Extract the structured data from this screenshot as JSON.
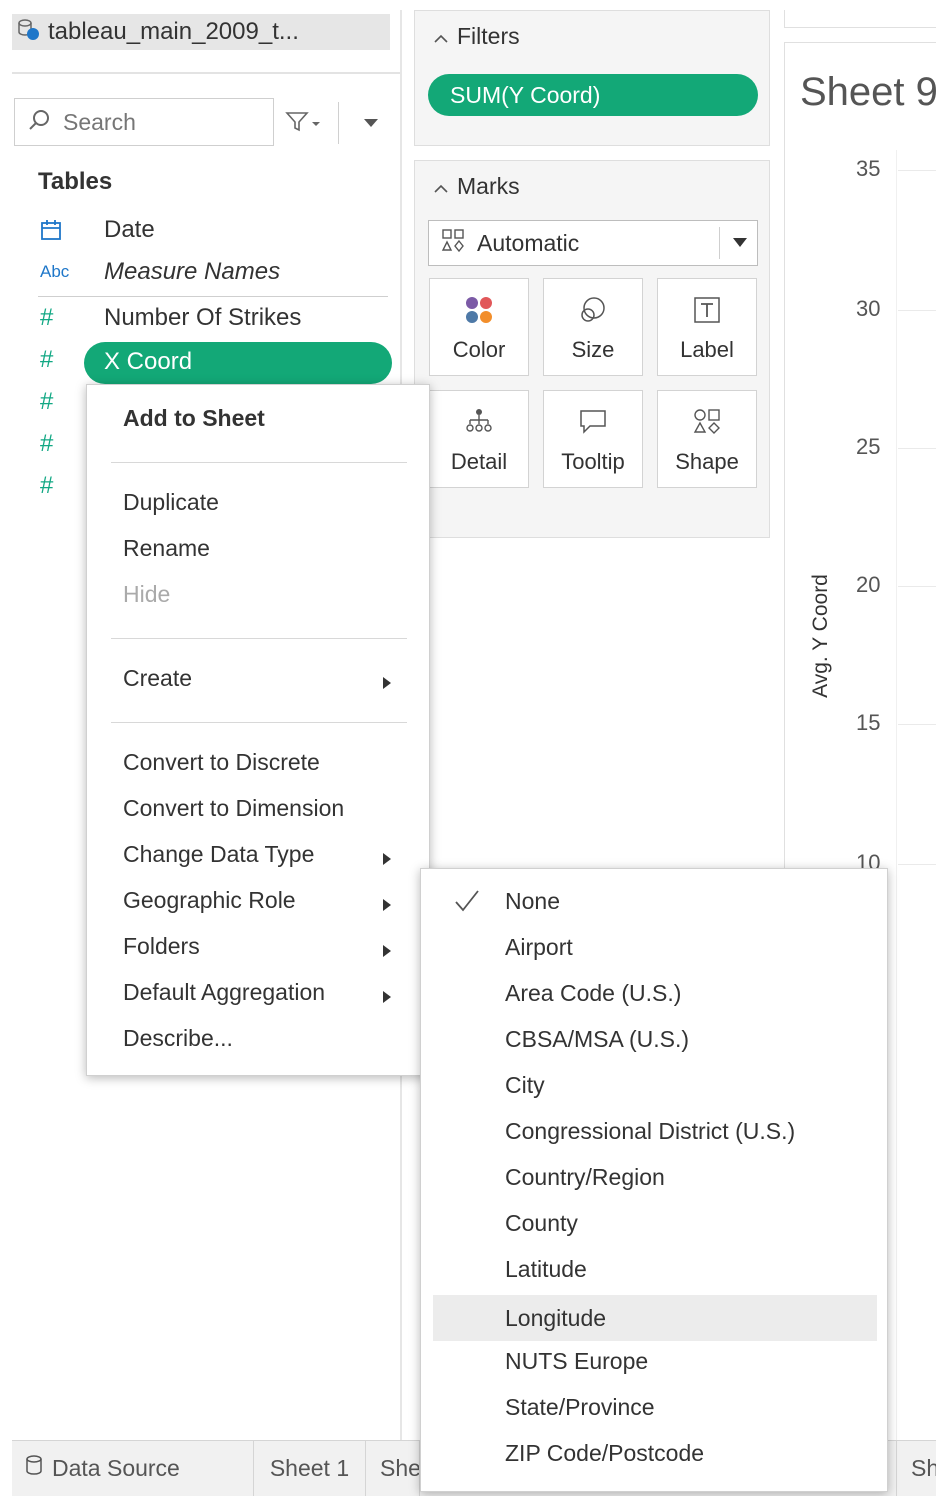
{
  "data_pane": {
    "datasource_name": "tableau_main_2009_t...",
    "search_placeholder": "Search",
    "tables_header": "Tables",
    "fields": [
      {
        "type_icon": "calendar-icon",
        "type_label": "",
        "name": "Date",
        "italic": false
      },
      {
        "type_icon": "abc-string-icon",
        "type_label": "Abc",
        "name": "Measure Names",
        "italic": true
      },
      {
        "type_icon": "number-hash-icon",
        "type_label": "#",
        "name": "Number Of Strikes",
        "italic": false
      },
      {
        "type_icon": "number-hash-icon",
        "type_label": "#",
        "name": "X Coord",
        "italic": false,
        "selected": true
      },
      {
        "type_icon": "number-hash-icon",
        "type_label": "#",
        "name": "",
        "italic": false
      },
      {
        "type_icon": "number-hash-icon",
        "type_label": "#",
        "name": "",
        "italic": false
      },
      {
        "type_icon": "number-hash-icon",
        "type_label": "#",
        "name": "",
        "italic": false
      }
    ]
  },
  "filters_card": {
    "title": "Filters",
    "pill": "SUM(Y Coord)"
  },
  "marks_card": {
    "title": "Marks",
    "mark_type": "Automatic",
    "buttons": [
      {
        "label": "Color",
        "icon": "color-dots-icon"
      },
      {
        "label": "Size",
        "icon": "size-circles-icon"
      },
      {
        "label": "Label",
        "icon": "label-text-icon"
      },
      {
        "label": "Detail",
        "icon": "detail-hierarchy-icon"
      },
      {
        "label": "Tooltip",
        "icon": "tooltip-bubble-icon"
      },
      {
        "label": "Shape",
        "icon": "shape-icon"
      }
    ]
  },
  "view": {
    "sheet_title": "Sheet 9",
    "y_axis_label": "Avg. Y Coord",
    "y_ticks": [
      "35",
      "30",
      "25",
      "20",
      "15",
      "10"
    ]
  },
  "tabs": {
    "data_source": "Data Source",
    "items": [
      "Sheet 1",
      "She",
      "Sh"
    ]
  },
  "context_menu": {
    "add_to_sheet": "Add to Sheet",
    "duplicate": "Duplicate",
    "rename": "Rename",
    "hide": "Hide",
    "create": "Create",
    "convert_to_discrete": "Convert to Discrete",
    "convert_to_dimension": "Convert to Dimension",
    "change_data_type": "Change Data Type",
    "geographic_role": "Geographic Role",
    "folders": "Folders",
    "default_aggregation": "Default Aggregation",
    "describe": "Describe..."
  },
  "geographic_role_submenu": {
    "checked_item": "None",
    "hovered_item": "Longitude",
    "items": [
      "None",
      "Airport",
      "Area Code (U.S.)",
      "CBSA/MSA (U.S.)",
      "City",
      "Congressional District (U.S.)",
      "Country/Region",
      "County",
      "Latitude",
      "Longitude",
      "NUTS Europe",
      "State/Province",
      "ZIP Code/Postcode"
    ]
  },
  "colors": {
    "accent_green": "#13a877",
    "field_icon_green": "#12a884",
    "menu_highlight": "#ececec"
  }
}
